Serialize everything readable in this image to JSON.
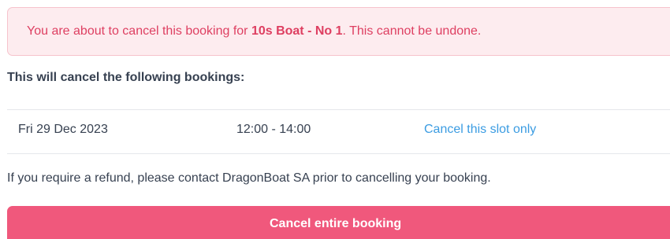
{
  "alert": {
    "prefix": "You are about to cancel this booking for ",
    "booking_name": "10s Boat - No 1",
    "suffix": ". This cannot be undone."
  },
  "bookings_heading": "This will cancel the following bookings:",
  "bookings": [
    {
      "date": "Fri 29 Dec 2023",
      "time": "12:00 - 14:00",
      "action_label": "Cancel this slot only"
    }
  ],
  "refund_note": "If you require a refund, please contact DragonBoat SA prior to cancelling your booking.",
  "cancel_button_label": "Cancel entire booking",
  "colors": {
    "alert_background": "#fdecef",
    "alert_border": "#f6c3cc",
    "alert_text": "#de3f61",
    "link": "#3b9ce2",
    "primary_button": "#f0587c",
    "body_text": "#374151"
  }
}
